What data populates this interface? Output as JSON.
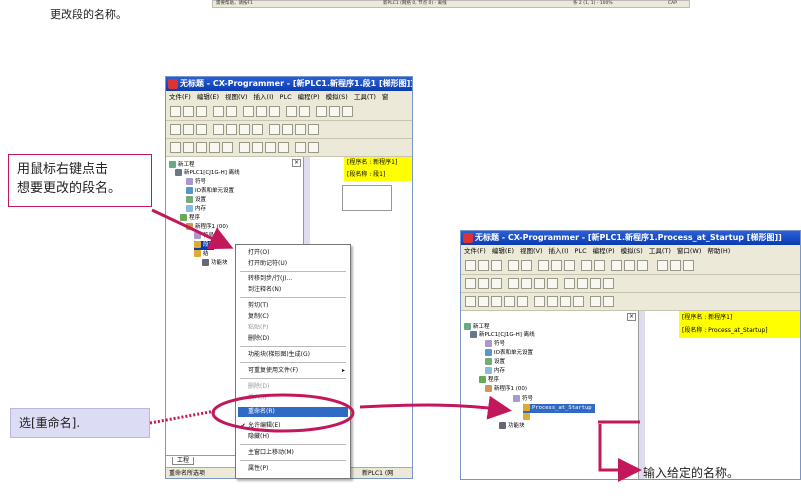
{
  "top_caption": "更改段的名称。",
  "top_statusbar": {
    "help": "需要帮助，请按F1",
    "plc": "新PLC1 (网络 0, 节点 0) - 离线",
    "rung": "条 2 (1, 1) - 100%",
    "cap": "CAP"
  },
  "window1": {
    "title": "无标题 - CX-Programmer - [新PLC1.新程序1.段1 [梯形图]]",
    "menu": [
      "文件(F)",
      "编辑(E)",
      "视图(V)",
      "插入(I)",
      "PLC",
      "编程(P)",
      "模拟(S)",
      "工具(T)",
      "窗"
    ],
    "tree": {
      "root": "新工程",
      "plc": "新PLC1[CJ1G-H] 离线",
      "symbols": "符号",
      "io": "IO表和单元设置",
      "settings": "设置",
      "memory": "内存",
      "programs": "程序",
      "newprog": "新程序1 (00)",
      "sym2": "符号",
      "sec": "段1",
      "end": "结",
      "fb": "功能块"
    },
    "program_name": "[程序名 : 新程序1]",
    "section_name": "[段名称 : 段1]",
    "tab": "工程",
    "status_left": "重命名所选项",
    "status_right": "新PLC1 (网"
  },
  "context_menu": {
    "items": [
      "打开(O)",
      "打开助记符(U)",
      "转移到步/行(J)...",
      "到注释名(N)",
      "剪切(T)",
      "复制(C)",
      "粘贴(P)",
      "删除(D)",
      "功能块(梯形图)生成(G)",
      "可重复使用文件(F)",
      "删除(D)",
      "插入(I)",
      "重命名(R)",
      "允许编辑(E)",
      "隐藏(H)",
      "主窗口上移动(M)",
      "属性(P)"
    ],
    "selected_index": 12
  },
  "callout1": {
    "line1": "用鼠标右键点击",
    "line2": "想要更改的段名。"
  },
  "callout2": "选[重命名].",
  "window2": {
    "title": "无标题 - CX-Programmer - [新PLC1.新程序1.Process_at_Startup [梯形图]]",
    "menu": [
      "文件(F)",
      "编辑(E)",
      "视图(V)",
      "插入(I)",
      "PLC",
      "编程(P)",
      "模拟(S)",
      "工具(T)",
      "窗口(W)",
      "帮助(H)"
    ],
    "tree": {
      "root": "新工程",
      "plc": "新PLC1[CJ1G-H] 离线",
      "symbols": "符号",
      "io": "IO表和单元设置",
      "settings": "设置",
      "memory": "内存",
      "programs": "程序",
      "newprog": "新程序1 (00)",
      "sym2": "符号",
      "edit": "Process_at_Startup",
      "fb": "功能块"
    },
    "program_name": "[程序名 : 新程序1]",
    "section_name": "[段名称 : Process_at_Startup]"
  },
  "bottom_caption": "输入给定的名称。",
  "colors": {
    "accent": "#c2185b",
    "callout_blue": "#dcdcf5",
    "highlight": "#ffff00",
    "titlebar": "#0a3cae"
  }
}
